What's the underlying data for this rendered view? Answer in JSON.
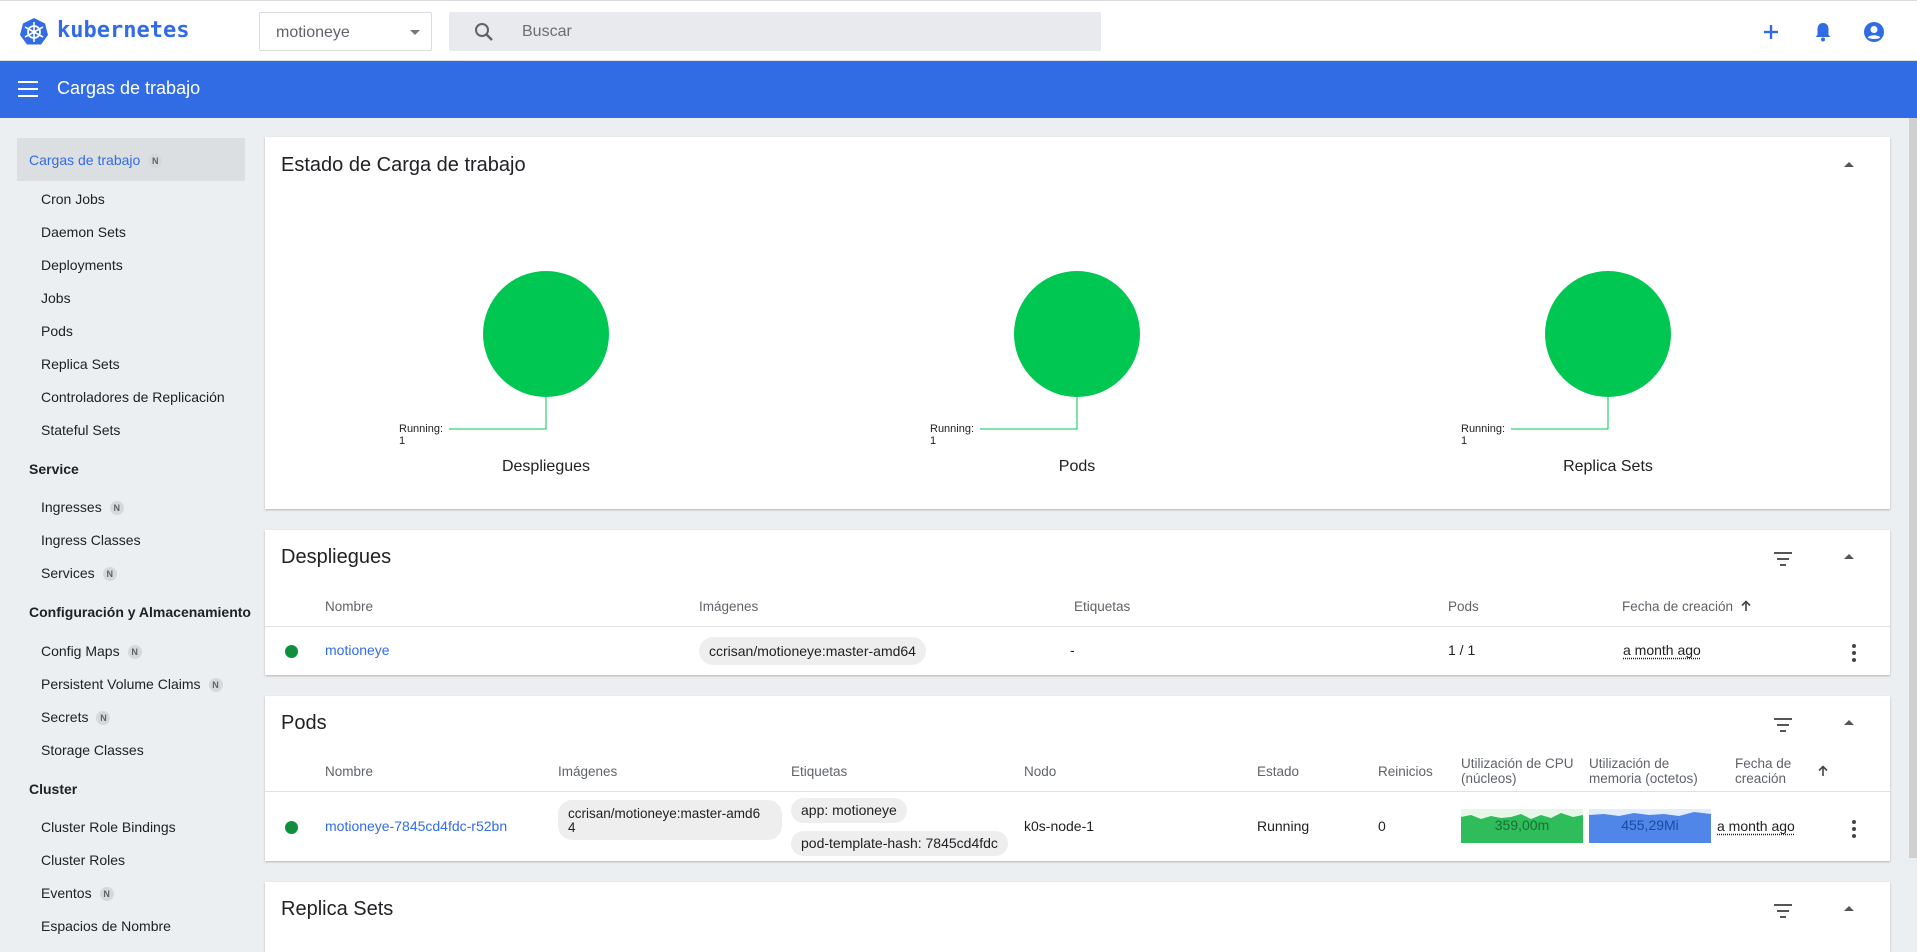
{
  "brand": {
    "name": "kubernetes",
    "color": "#326ce5"
  },
  "topbar": {
    "namespace": "motioneye",
    "search_placeholder": "Buscar",
    "icons": [
      "add-icon",
      "bell-icon",
      "account-icon"
    ]
  },
  "header": {
    "title": "Cargas de trabajo"
  },
  "sidebar": {
    "workloads": {
      "label": "Cargas de trabajo",
      "badge": "N"
    },
    "workload_items": [
      "Cron Jobs",
      "Daemon Sets",
      "Deployments",
      "Jobs",
      "Pods",
      "Replica Sets",
      "Controladores de Replicación",
      "Stateful Sets"
    ],
    "service_title": "Service",
    "service_items": [
      {
        "label": "Ingresses",
        "badge": "N"
      },
      {
        "label": "Ingress Classes"
      },
      {
        "label": "Services",
        "badge": "N"
      }
    ],
    "config_title": "Configuración y Almacenamiento",
    "config_items": [
      {
        "label": "Config Maps",
        "badge": "N"
      },
      {
        "label": "Persistent Volume Claims",
        "badge": "N"
      },
      {
        "label": "Secrets",
        "badge": "N"
      },
      {
        "label": "Storage Classes"
      }
    ],
    "cluster_title": "Cluster",
    "cluster_items": [
      {
        "label": "Cluster Role Bindings"
      },
      {
        "label": "Cluster Roles"
      },
      {
        "label": "Eventos",
        "badge": "N"
      },
      {
        "label": "Espacios de Nombre"
      }
    ]
  },
  "status_card": {
    "title": "Estado de Carga de trabajo",
    "charts": [
      {
        "label": "Despliegues",
        "legend": "Running: 1"
      },
      {
        "label": "Pods",
        "legend": "Running: 1"
      },
      {
        "label": "Replica Sets",
        "legend": "Running: 1"
      }
    ],
    "running_color": "#00c752"
  },
  "deployments": {
    "title": "Despliegues",
    "headers": [
      "Nombre",
      "Imágenes",
      "Etiquetas",
      "Pods",
      "Fecha de creación"
    ],
    "row": {
      "name": "motioneye",
      "image": "ccrisan/motioneye:master-amd64",
      "labels": "-",
      "pods": "1 / 1",
      "created": "a month ago"
    }
  },
  "pods": {
    "title": "Pods",
    "headers": {
      "name": "Nombre",
      "images": "Imágenes",
      "labels": "Etiquetas",
      "node": "Nodo",
      "status": "Estado",
      "restarts": "Reinicios",
      "cpu1": "Utilización de CPU",
      "cpu2": "(núcleos)",
      "mem1": "Utilización de",
      "mem2": "memoria (octetos)",
      "date1": "Fecha de",
      "date2": "creación"
    },
    "row": {
      "name": "motioneye-7845cd4fdc-r52bn",
      "image1": "ccrisan/motioneye:master-amd6",
      "image2": "4",
      "label1": "app: motioneye",
      "label2": "pod-template-hash: 7845cd4fdc",
      "node": "k0s-node-1",
      "status": "Running",
      "restarts": "0",
      "cpu": "359,00m",
      "memory": "455,29Mi",
      "created": "a month ago"
    }
  },
  "replicasets": {
    "title": "Replica Sets"
  }
}
